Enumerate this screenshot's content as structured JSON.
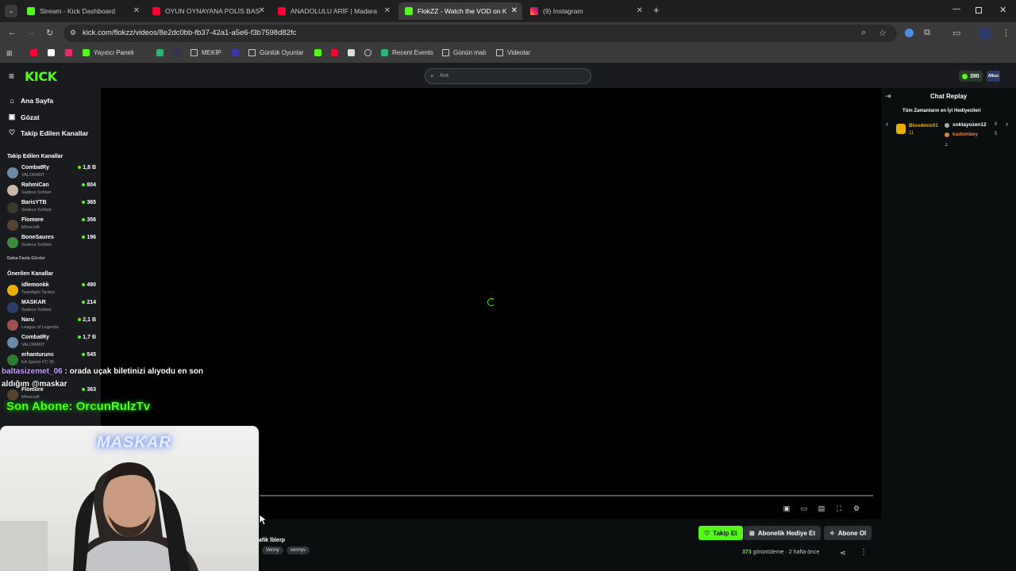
{
  "browser": {
    "tabs": [
      {
        "title": "Stream - Kick Dashboard",
        "icon": "kick-icon",
        "active": false
      },
      {
        "title": "OYUN OYNAYANA POLİS BASKI",
        "icon": "youtube-icon",
        "active": false
      },
      {
        "title": "ANADOLULU ARİF | Madara Oli",
        "icon": "youtube-icon",
        "active": false
      },
      {
        "title": "FlokZZ - Watch the VOD on Kic",
        "icon": "kick-icon",
        "active": true
      },
      {
        "title": "(9) Instagram",
        "icon": "instagram-icon",
        "active": false
      }
    ],
    "new_tab": "+",
    "url": "kick.com/flokzz/videos/8e2dc0bb-fb37-42a1-a5e6-f3b7598d82fc",
    "bookmarks": [
      {
        "label": "",
        "icon": "youtube-icon"
      },
      {
        "label": "",
        "icon": "x-icon"
      },
      {
        "label": "",
        "icon": "instagram-icon"
      },
      {
        "label": "Yayıncı Paneli",
        "icon": "kick-icon"
      },
      {
        "label": "",
        "icon": "app-icon"
      },
      {
        "label": "",
        "icon": "prompt-icon"
      },
      {
        "label": "MEKİP",
        "icon": "folder-icon"
      },
      {
        "label": "",
        "icon": "app-icon"
      },
      {
        "label": "Günlük Oyunlar",
        "icon": "folder-icon"
      },
      {
        "label": "",
        "icon": "kick-icon"
      },
      {
        "label": "",
        "icon": "youtube-icon"
      },
      {
        "label": "",
        "icon": "image-icon"
      },
      {
        "label": "",
        "icon": "globe-icon"
      },
      {
        "label": "Recent Events",
        "icon": "app-icon"
      },
      {
        "label": "Günün malı",
        "icon": "folder-icon"
      },
      {
        "label": "Videolar",
        "icon": "folder-icon"
      }
    ]
  },
  "kick": {
    "logo": "KICK",
    "search_placeholder": "Ara",
    "points": "390",
    "avatar_text": "Afkuz"
  },
  "sidebar": {
    "nav": [
      {
        "label": "Ana Sayfa",
        "icon": "home-icon"
      },
      {
        "label": "Gözat",
        "icon": "browse-icon"
      },
      {
        "label": "Takip Edilen Kanallar",
        "icon": "heart-icon"
      }
    ],
    "followed_title": "Takip Edilen Kanallar",
    "followed": [
      {
        "name": "CombatRy",
        "category": "VALORANT",
        "viewers": "1,8 B"
      },
      {
        "name": "RahmiCan",
        "category": "Sadece Sohbet",
        "viewers": "804"
      },
      {
        "name": "BarisYTB",
        "category": "Sadece Sohbet",
        "viewers": "365"
      },
      {
        "name": "Flomore",
        "category": "Minecraft",
        "viewers": "356"
      },
      {
        "name": "BoneSaures",
        "category": "Sadece Sohbet",
        "viewers": "196"
      }
    ],
    "show_more": "Daha Fazla Göster",
    "recommended_title": "Önerilen Kanallar",
    "recommended": [
      {
        "name": "idlemonkk",
        "category": "Teamfight Tactics",
        "viewers": "490"
      },
      {
        "name": "MASKAR",
        "category": "Sadece Sohbet",
        "viewers": "214"
      },
      {
        "name": "Naru",
        "category": "League of Legends",
        "viewers": "2,1 B"
      },
      {
        "name": "CombatRy",
        "category": "VALORANT",
        "viewers": "1,7 B"
      },
      {
        "name": "erhanturunc",
        "category": "EA Sports FC 26",
        "viewers": "545"
      },
      {
        "name": "Flomore",
        "category": "Minecraft",
        "viewers": "363"
      }
    ]
  },
  "chat": {
    "title": "Chat Replay",
    "gifters_title": "Tüm Zamanların en İyi Hediyecileri",
    "gifters": [
      {
        "name": "Bloodmix01",
        "count": "11"
      },
      {
        "name": "xoktayozen12",
        "count": "6"
      },
      {
        "name": "kadombey",
        "count": "5"
      }
    ]
  },
  "video": {
    "title_partial": "afik lblerp",
    "tags": [
      "Venny",
      "vennyv"
    ],
    "follow_label": "Takip Et",
    "gift_sub_label": "Abonelik Hediye Et",
    "subscribe_label": "Abone Ol",
    "views_count": "373",
    "views_label": "görüntüleme",
    "ago": "2 hafta önce"
  },
  "overlay": {
    "chat_user": "baltasizemet_06",
    "chat_message": ": orada uçak biletinizi alıyodu en son aldığım @maskar",
    "sub_alert": "Son Abone: OrcunRulzTv",
    "webcam_neon": "MASKAR"
  },
  "colors": {
    "kick_green": "#53fc18",
    "bg": "#0b0e0f",
    "sidebar_bg": "#191b1f"
  }
}
